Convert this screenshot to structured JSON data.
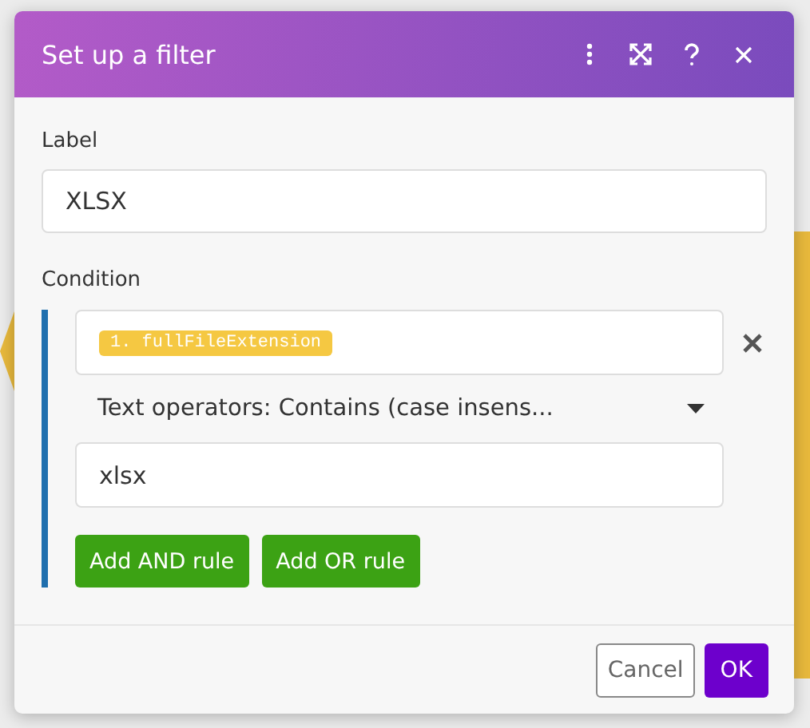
{
  "dialog": {
    "title": "Set up a filter"
  },
  "label": {
    "caption": "Label",
    "value": "XLSX"
  },
  "condition": {
    "caption": "Condition",
    "rule": {
      "field_tag": "1. fullFileExtension",
      "operator": "Text operators: Contains (case insens...",
      "value": "xlsx"
    },
    "buttons": [
      "Add AND rule",
      "Add OR rule"
    ]
  },
  "footer": {
    "cancel": "Cancel",
    "ok": "OK"
  }
}
